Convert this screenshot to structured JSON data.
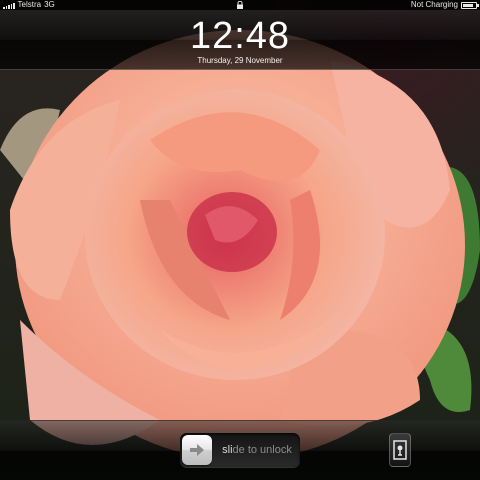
{
  "status_bar": {
    "carrier": "Telstra",
    "network": "3G",
    "charging_text": "Not Charging",
    "battery_level": 0.85,
    "icons": [
      "signal-icon",
      "lock-icon",
      "battery-icon"
    ]
  },
  "clock": {
    "time": "12:48",
    "date": "Thursday, 29 November"
  },
  "unlock_slider": {
    "label_prefix": "sli",
    "label_rest": "de to unlock",
    "knob_icon": "arrow-right-icon"
  },
  "picture_frame_button": {
    "icon": "picture-frame-icon"
  },
  "wallpaper": {
    "subject": "rose",
    "colors": {
      "petal_light": "#f7b8a2",
      "petal_mid": "#f0907a",
      "petal_deep": "#d65a58",
      "leaf": "#3f7a32"
    }
  }
}
